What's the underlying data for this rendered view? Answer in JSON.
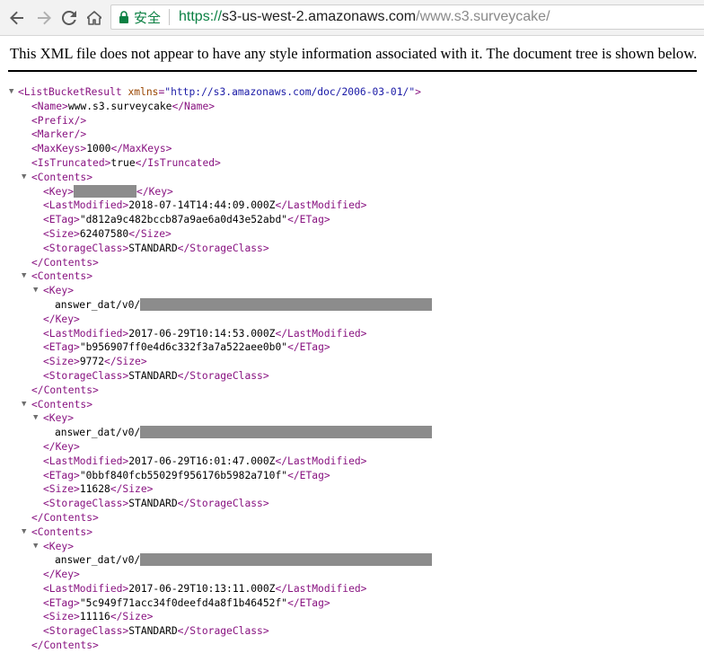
{
  "browser": {
    "secure_label": "安全",
    "url_scheme": "https://",
    "url_host": "s3-us-west-2.amazonaws.com",
    "url_path": "/www.s3.surveycake/"
  },
  "notice": "This XML file does not appear to have any style information associated with it. The document tree is shown below.",
  "xml": {
    "root_open": "<ListBucketResult",
    "xmlns_attr": "xmlns",
    "xmlns_val": "\"http://s3.amazonaws.com/doc/2006-03-01/\"",
    "root_close_bracket": ">",
    "name_open": "<Name>",
    "name_val": "www.s3.surveycake",
    "name_close": "</Name>",
    "prefix": "<Prefix/>",
    "marker": "<Marker/>",
    "maxkeys_open": "<MaxKeys>",
    "maxkeys_val": "1000",
    "maxkeys_close": "</MaxKeys>",
    "truncated_open": "<IsTruncated>",
    "truncated_val": "true",
    "truncated_close": "</IsTruncated>",
    "contents_open": "<Contents>",
    "contents_close": "</Contents>",
    "key_open": "<Key>",
    "key_close": "</Key>",
    "lm_open": "<LastModified>",
    "lm_close": "</LastModified>",
    "etag_open": "<ETag>",
    "etag_close": "</ETag>",
    "size_open": "<Size>",
    "size_close": "</Size>",
    "sc_open": "<StorageClass>",
    "sc_close": "</StorageClass>",
    "key_prefix": "answer_dat/v0/",
    "contents": [
      {
        "last_modified": "2018-07-14T14:44:09.000Z",
        "etag": "\"d812a9c482bccb87a9ae6a0d43e52abd\"",
        "size": "62407580",
        "storage_class": "STANDARD"
      },
      {
        "last_modified": "2017-06-29T10:14:53.000Z",
        "etag": "\"b956907ff0e4d6c332f3a7a522aee0b0\"",
        "size": "9772",
        "storage_class": "STANDARD"
      },
      {
        "last_modified": "2017-06-29T16:01:47.000Z",
        "etag": "\"0bbf840fcb55029f956176b5982a710f\"",
        "size": "11628",
        "storage_class": "STANDARD"
      },
      {
        "last_modified": "2017-06-29T10:13:11.000Z",
        "etag": "\"5c949f71acc34f0deefd4a8f1b46452f\"",
        "size": "11116",
        "storage_class": "STANDARD"
      }
    ]
  }
}
